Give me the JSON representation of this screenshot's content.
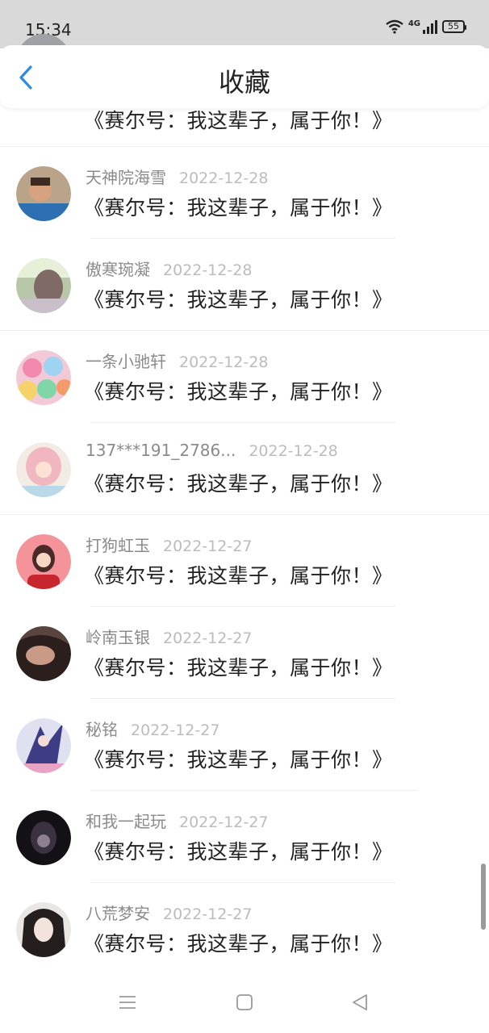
{
  "status_bar": {
    "time": "15:34",
    "network": "4G",
    "battery": "55"
  },
  "header": {
    "title": "收藏",
    "back_icon": "chevron-left-icon"
  },
  "list": {
    "partial_top_title": "《赛尔号：我这辈子，属于你！》",
    "items": [
      {
        "name": "天神院海雪",
        "date": "2022-12-28",
        "title": "《赛尔号：我这辈子，属于你！》",
        "avatar_color": "#4a7fb0"
      },
      {
        "name": "傲寒琬凝",
        "date": "2022-12-28",
        "title": "《赛尔号：我这辈子，属于你！》",
        "avatar_color": "#b8a5a0"
      },
      {
        "name": "一条小驰轩",
        "date": "2022-12-28",
        "title": "《赛尔号：我这辈子，属于你！》",
        "avatar_color": "#e48aa8"
      },
      {
        "name": "137***191_2786...",
        "date": "2022-12-28",
        "title": "《赛尔号：我这辈子，属于你！》",
        "avatar_color": "#e9c4c0"
      },
      {
        "name": "打狗虹玉",
        "date": "2022-12-27",
        "title": "《赛尔号：我这辈子，属于你！》",
        "avatar_color": "#f08a8a"
      },
      {
        "name": "岭南玉银",
        "date": "2022-12-27",
        "title": "《赛尔号：我这辈子，属于你！》",
        "avatar_color": "#3a2a28"
      },
      {
        "name": "秘铭",
        "date": "2022-12-27",
        "title": "《赛尔号：我这辈子，属于你！》",
        "avatar_color": "#5a5ea8"
      },
      {
        "name": "和我一起玩",
        "date": "2022-12-27",
        "title": "《赛尔号：我这辈子，属于你！》",
        "avatar_color": "#1e1a20"
      },
      {
        "name": "八荒梦安",
        "date": "2022-12-27",
        "title": "《赛尔号：我这辈子，属于你！》",
        "avatar_color": "#332c2c"
      }
    ]
  },
  "nav_icons": {
    "menu": "menu-icon",
    "home": "home-icon",
    "back": "back-triangle-icon"
  },
  "colors": {
    "accent": "#2f8ce0",
    "status_bar_bg": "#d9d9d9",
    "name_text": "#8b8b8b",
    "date_text": "#bcbcbc",
    "title_text": "#222222"
  }
}
